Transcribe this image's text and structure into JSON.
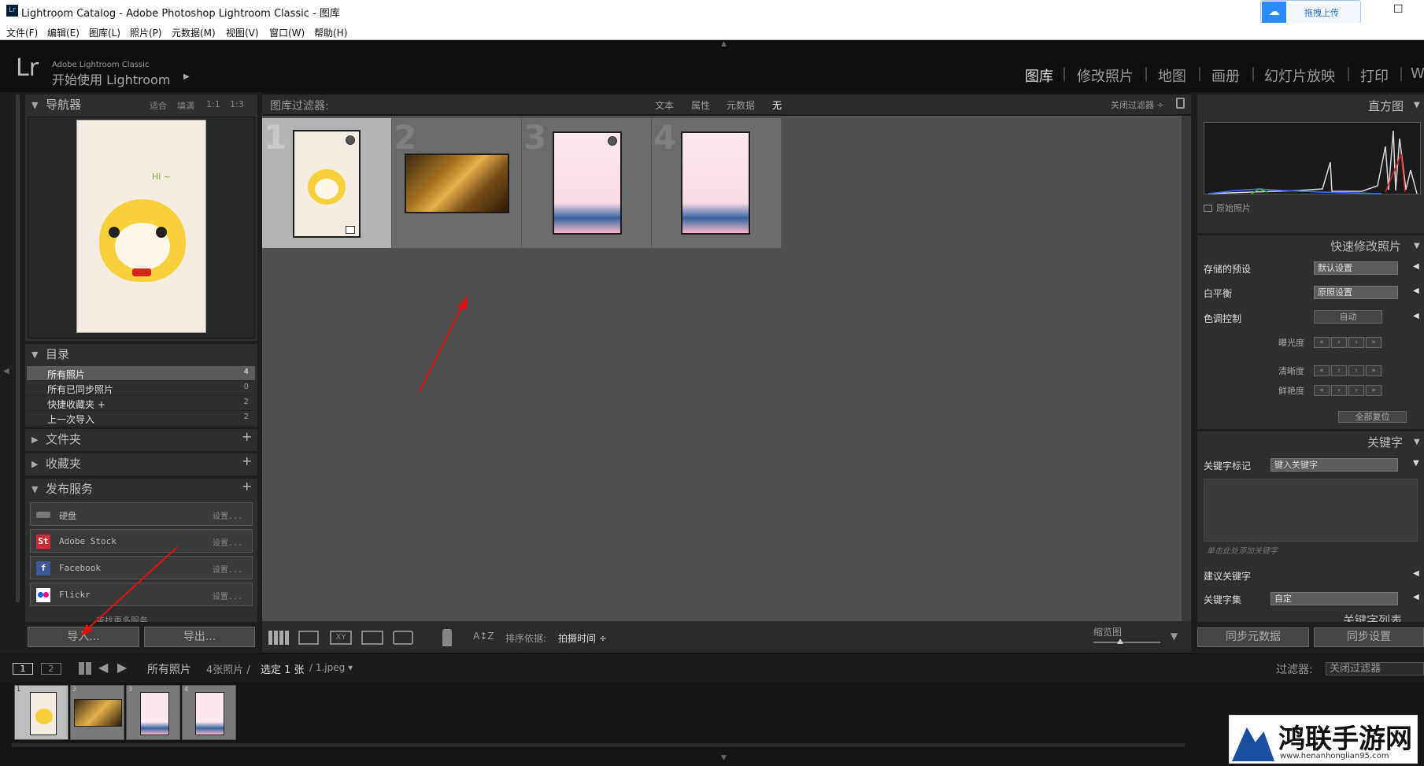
{
  "window": {
    "app_icon": "Lr",
    "title": "Lightroom Catalog - Adobe Photoshop Lightroom Classic - 图库",
    "cloud_upload_label": "拖拽上传",
    "close_label": "✕",
    "maximize_label": "☐"
  },
  "menu": [
    "文件(F)",
    "编辑(E)",
    "图库(L)",
    "照片(P)",
    "元数据(M)",
    "视图(V)",
    "窗口(W)",
    "帮助(H)"
  ],
  "identity": {
    "logo": "Lr",
    "product": "Adobe Lightroom Classic",
    "tagline": "开始使用 Lightroom",
    "arrow": "▶"
  },
  "modules": [
    "图库",
    "修改照片",
    "地图",
    "画册",
    "幻灯片放映",
    "打印",
    "W"
  ],
  "navigator": {
    "title": "导航器",
    "zoom_options": [
      "适合",
      "填满",
      "1:1",
      "1:3"
    ],
    "preview_text": "Hi ~"
  },
  "catalog": {
    "title": "目录",
    "rows": [
      {
        "label": "所有照片",
        "count": "4"
      },
      {
        "label": "所有已同步照片",
        "count": "0"
      },
      {
        "label": "快捷收藏夹 +",
        "count": "2"
      },
      {
        "label": "上一次导入",
        "count": "2"
      }
    ]
  },
  "folders": {
    "title": "文件夹",
    "add": "+"
  },
  "collections": {
    "title": "收藏夹",
    "add": "+"
  },
  "publish": {
    "title": "发布服务",
    "add": "+",
    "services": [
      {
        "name": "硬盘",
        "icon": "hard-drive-icon",
        "setup": "设置..."
      },
      {
        "name": "Adobe Stock",
        "icon": "adobe-stock-icon",
        "icon_text": "St",
        "setup": "设置..."
      },
      {
        "name": "Facebook",
        "icon": "facebook-icon",
        "icon_text": "f",
        "setup": "设置..."
      },
      {
        "name": "Flickr",
        "icon": "flickr-icon",
        "setup": "设置..."
      }
    ],
    "more": "查找更多服务..."
  },
  "left_buttons": {
    "import": "导入...",
    "export": "导出..."
  },
  "filter_bar": {
    "label": "图库过滤器:",
    "options": [
      "文本",
      "属性",
      "元数据",
      "无"
    ],
    "active": "无",
    "close_filter": "关闭过滤器 ÷"
  },
  "grid": {
    "cells": [
      {
        "index": "1",
        "selected": true,
        "thumb": "chick-illustration"
      },
      {
        "index": "2",
        "selected": false,
        "thumb": "autumn-leaf-photo"
      },
      {
        "index": "3",
        "selected": false,
        "thumb": "cherry-blossom-card"
      },
      {
        "index": "4",
        "selected": false,
        "thumb": "cherry-blossom-card"
      }
    ]
  },
  "toolbar": {
    "sort_label": "排序依据:",
    "sort_value": "拍摄时间 ÷",
    "thumb_label": "缩览图",
    "sort_icon": "A↕Z"
  },
  "histogram": {
    "title": "直方图",
    "original_photo": "原始照片"
  },
  "quick_develop": {
    "title": "快速修改照片",
    "saved_preset_label": "存储的预设",
    "saved_preset_value": "默认设置",
    "white_balance_label": "白平衡",
    "white_balance_value": "原照设置",
    "tone_label": "色调控制",
    "auto_label": "自动",
    "rows": [
      "曝光度",
      "清晰度",
      "鲜艳度"
    ],
    "reset_all": "全部复位",
    "stepper": [
      "«",
      "‹",
      "›",
      "»"
    ]
  },
  "keywording": {
    "title": "关键字",
    "tags_label": "关键字标记",
    "tags_placeholder": "键入关键字",
    "add_hint": "单击此处添加关键字",
    "suggest_label": "建议关键字",
    "set_label": "关键字集",
    "set_value": "自定",
    "list_label": "关键字列表"
  },
  "right_buttons": {
    "sync_meta": "同步元数据",
    "sync_settings": "同步设置"
  },
  "filmstrip": {
    "page1": "1",
    "page2": "2",
    "source": "所有照片",
    "count_text": "4张照片 /",
    "selected_text": "选定 1 张",
    "file_text": "/ 1.jpeg ▾",
    "filter_label": "过滤器:",
    "filter_value": "关闭过滤器",
    "cells": [
      "1",
      "2",
      "3",
      "4"
    ]
  },
  "watermark": {
    "site": "鸿联手游网",
    "url": "www.henanhonglian95.com"
  },
  "colors": {
    "accent": "#e0e0e0",
    "panel": "#2e2e2e",
    "grid_bg": "#505050",
    "arrow": "#e01010"
  }
}
